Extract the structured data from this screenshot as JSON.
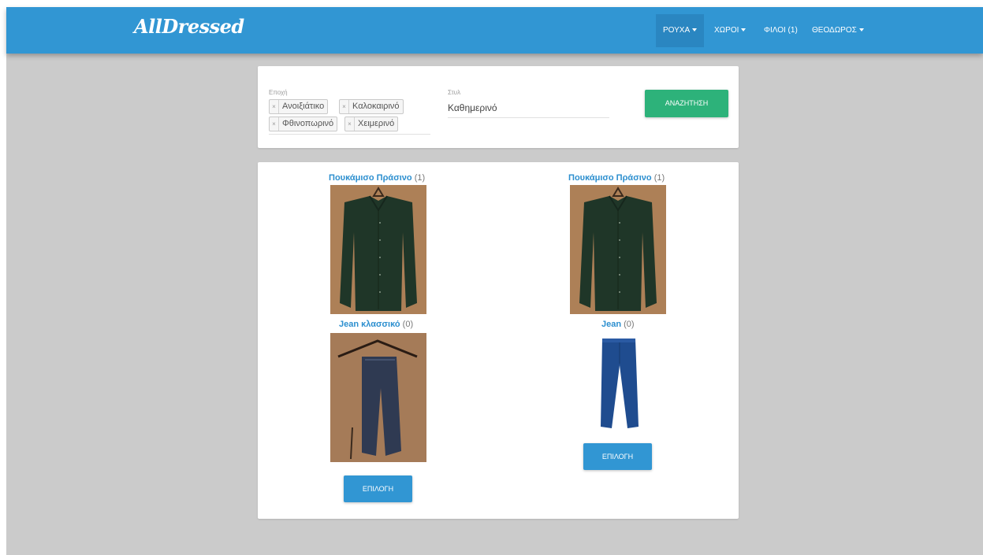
{
  "navbar": {
    "logo": "AllDressed",
    "items": [
      {
        "label": "ΡΟΥΧΑ",
        "dropdown": true
      },
      {
        "label": "ΧΩΡΟΙ",
        "dropdown": true
      },
      {
        "label": "ΦΙΛΟΙ (1)",
        "dropdown": false
      },
      {
        "label": "ΘΕΟΔΩΡΟΣ",
        "dropdown": true
      }
    ]
  },
  "filters": {
    "season_label": "Εποχή",
    "season_tags": [
      "Ανοιξιάτικο",
      "Καλοκαιρινό",
      "Φθινοπωρινό",
      "Χειμερινό"
    ],
    "style_label": "Στυλ",
    "style_value": "Καθημερινό",
    "search_button": "ΑΝΑΖΗΤΗΣΗ"
  },
  "results": {
    "items": [
      {
        "name": "Πουκάμισο Πράσινο",
        "count": "(1)",
        "image": "green-shirt"
      },
      {
        "name": "Πουκάμισο Πράσινο",
        "count": "(1)",
        "image": "green-shirt"
      },
      {
        "name": "Jean κλασσικό",
        "count": "(0)",
        "image": "jeans-on-hanger"
      },
      {
        "name": "Jean",
        "count": "(0)",
        "image": "blue-jeans"
      }
    ],
    "select_button": "ΕΠΙΛΟΓΗ"
  },
  "colors": {
    "navbar": "#3196d3",
    "accent_green": "#2db27a",
    "link_blue": "#2c8fcf",
    "background": "#cbcbcb"
  }
}
